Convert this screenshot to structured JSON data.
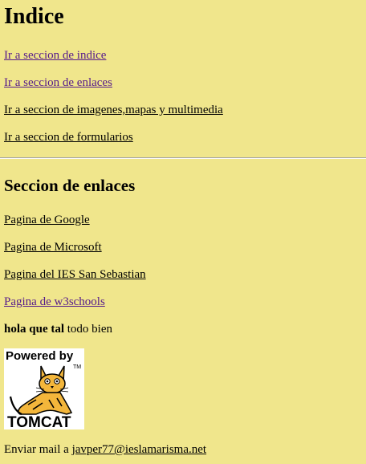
{
  "index": {
    "title": "Indice",
    "links": [
      {
        "label": "Ir a seccion de indice"
      },
      {
        "label": "Ir a seccion de enlaces"
      },
      {
        "label": "Ir a seccion de imagenes,mapas y multimedia"
      },
      {
        "label": "Ir a seccion de formularios"
      }
    ]
  },
  "links_section": {
    "title": "Seccion de enlaces",
    "links": [
      {
        "label": "Pagina de Google"
      },
      {
        "label": "Pagina de Microsoft"
      },
      {
        "label": "Pagina del IES San Sebastian"
      },
      {
        "label": "Pagina de w3schools"
      }
    ],
    "greeting_bold": "hola que tal",
    "greeting_rest": " todo bien"
  },
  "logo": {
    "top_text": "Powered by",
    "tm": "TM",
    "bottom_text": "TOMCAT"
  },
  "footer": {
    "prefix": "Enviar mail a ",
    "email": "javper77@ieslamarisma.net"
  },
  "colors": {
    "background": "#f0e68c",
    "visited_link": "#551a8b",
    "link": "#000000"
  }
}
